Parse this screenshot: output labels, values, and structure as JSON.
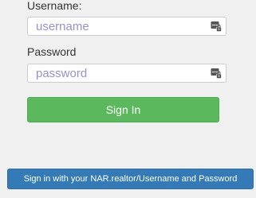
{
  "form": {
    "username_label": "Username:",
    "username_placeholder": "username",
    "username_value": "",
    "password_label": "Password",
    "password_placeholder": "password",
    "password_value": "",
    "field_icon": "password-manager-icon",
    "signin_label": "Sign In",
    "nar_signin_label": "Sign in with your NAR.realtor/Username and Password"
  },
  "colors": {
    "page_background": "#f0f0f0",
    "placeholder": "#9a8fd0",
    "signin_button": "#5cb85c",
    "nar_button": "#337ab7"
  }
}
